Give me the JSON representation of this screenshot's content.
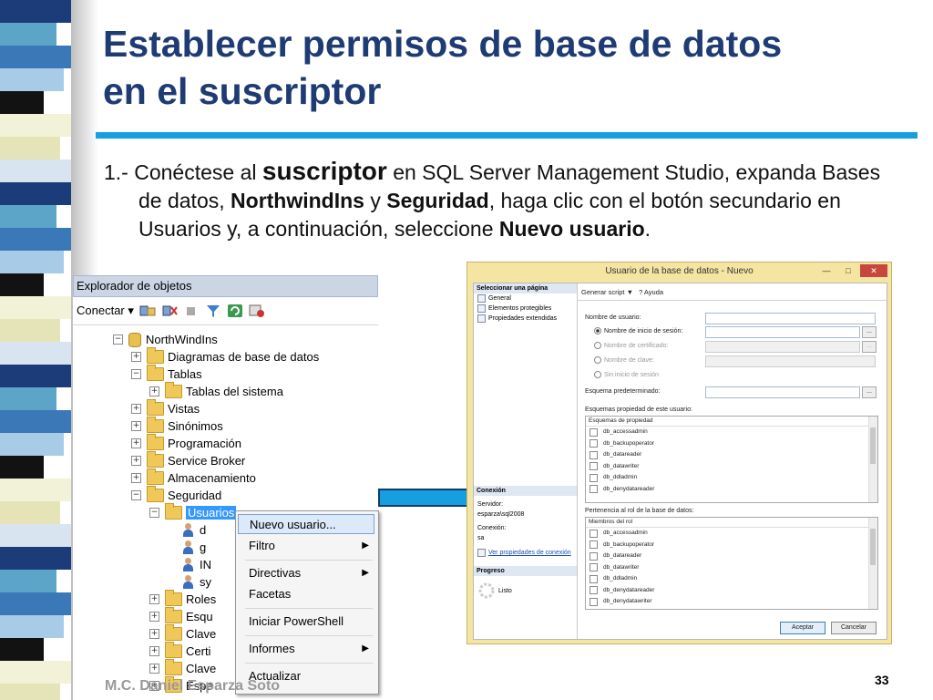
{
  "slide": {
    "title_line1": "Establecer permisos de base de datos",
    "title_line2": "en el suscriptor",
    "body": {
      "p1_a": "1.- Conéctese al ",
      "p1_big": "suscriptor",
      "p1_b": " en SQL Server Management Studio, expanda Bases de datos, ",
      "b1": "NorthwindIns",
      "p1_c": " y ",
      "b2": "Seguridad",
      "p1_d": ", haga clic con el botón secundario en Usuarios y, a continuación, seleccione ",
      "b3": "Nuevo usuario",
      "p1_e": "."
    },
    "footer": "M.C. Daniel Esparza Soto",
    "page_number": "33"
  },
  "object_explorer": {
    "title": "Explorador de objetos",
    "connect_label": "Conectar",
    "tree": [
      {
        "label": "NorthWindIns",
        "expander": "−"
      },
      {
        "label": "Diagramas de base de datos",
        "expander": "+"
      },
      {
        "label": "Tablas",
        "expander": "−"
      },
      {
        "label": "Tablas del sistema",
        "expander": "+"
      },
      {
        "label": "Vistas",
        "expander": "+"
      },
      {
        "label": "Sinónimos",
        "expander": "+"
      },
      {
        "label": "Programación",
        "expander": "+"
      },
      {
        "label": "Service Broker",
        "expander": "+"
      },
      {
        "label": "Almacenamiento",
        "expander": "+"
      },
      {
        "label": "Seguridad",
        "expander": "−"
      },
      {
        "label": "Usuarios",
        "expander": "−"
      },
      {
        "label": "d"
      },
      {
        "label": "g"
      },
      {
        "label": "IN"
      },
      {
        "label": "sy"
      },
      {
        "label": "Roles",
        "expander": "+"
      },
      {
        "label": "Esqu",
        "expander": "+"
      },
      {
        "label": "Clave",
        "expander": "+"
      },
      {
        "label": "Certi",
        "expander": "+"
      },
      {
        "label": "Clave",
        "expander": "+"
      },
      {
        "label": "Espe",
        "expander": "+"
      }
    ]
  },
  "context_menu": {
    "items": [
      {
        "label": "Nuevo usuario..."
      },
      {
        "label": "Filtro",
        "submenu": "▶"
      },
      {
        "label": "Directivas",
        "submenu": "▶"
      },
      {
        "label": "Facetas"
      },
      {
        "label": "Iniciar PowerShell"
      },
      {
        "label": "Informes",
        "submenu": "▶"
      },
      {
        "label": "Actualizar"
      }
    ]
  },
  "dialog": {
    "title": "Usuario de la base de datos - Nuevo",
    "window_buttons": {
      "minimize": "—",
      "maximize": "□",
      "close": "✕"
    },
    "select_page_header": "Seleccionar una página",
    "pages": [
      "General",
      "Elementos protegibles",
      "Propiedades extendidas"
    ],
    "connection_header": "Conexión",
    "server_label": "Servidor:",
    "server_value": "esparza\\sql2008",
    "connection_label": "Conexión:",
    "connection_value": "sa",
    "view_props_link": "Ver propiedades de conexión",
    "progress_header": "Progreso",
    "progress_status": "Listo",
    "toolbar": {
      "script": "Generar script",
      "script_arrow": "▼",
      "help": "Ayuda"
    },
    "user_name_label": "Nombre de usuario:",
    "options": [
      {
        "label": "Nombre de inicio de sesión:",
        "selected": true
      },
      {
        "label": "Nombre de certificado:",
        "selected": false
      },
      {
        "label": "Nombre de clave:",
        "selected": false
      },
      {
        "label": "Sin inicio de sesión",
        "selected": false
      }
    ],
    "browse": "...",
    "default_schema_label": "Esquema predeterminado:",
    "owned_schemas_label": "Esquemas propiedad de este usuario:",
    "owned_schemas_header": "Esquemas de propiedad",
    "owned_schemas": [
      "db_accessadmin",
      "db_backupoperator",
      "db_datareader",
      "db_datawriter",
      "db_ddladmin",
      "db_denydatareader"
    ],
    "role_membership_label": "Pertenencia al rol de la base de datos:",
    "role_header": "Miembros del rol",
    "roles": [
      "db_accessadmin",
      "db_backupoperator",
      "db_datareader",
      "db_datawriter",
      "db_ddladmin",
      "db_denydatareader",
      "db_denydatawriter"
    ],
    "ok": "Aceptar",
    "cancel": "Cancelar"
  },
  "colors": {
    "title": "#1f3b73",
    "rule": "#169ee0",
    "selection": "#3399ff",
    "dialog_frame": "#f4e5a3"
  }
}
